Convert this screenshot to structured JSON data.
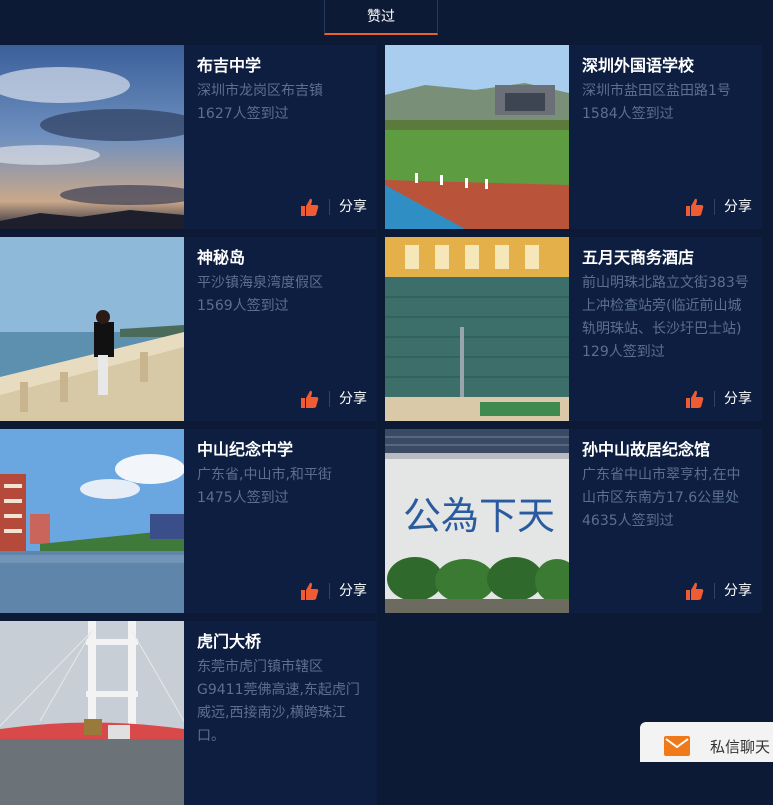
{
  "tabs": {
    "active_label": "赞过"
  },
  "cards": [
    {
      "title": "布吉中学",
      "address": "深圳市龙岗区布吉镇",
      "count": "1627人签到过",
      "share": "分享"
    },
    {
      "title": "深圳外国语学校",
      "address": "深圳市盐田区盐田路1号",
      "count": "1584人签到过",
      "share": "分享"
    },
    {
      "title": "神秘岛",
      "address": "平沙镇海泉湾度假区",
      "count": "1569人签到过",
      "share": "分享"
    },
    {
      "title": "五月天商务酒店",
      "address": "前山明珠北路立文街383号上冲检查站旁(临近前山城轨明珠站、长沙圩巴士站)",
      "count": "129人签到过",
      "share": "分享"
    },
    {
      "title": "中山纪念中学",
      "address": "广东省,中山市,和平街",
      "count": "1475人签到过",
      "share": "分享"
    },
    {
      "title": "孙中山故居纪念馆",
      "address": "广东省中山市翠亨村,在中山市区东南方17.6公里处",
      "count": "4635人签到过",
      "share": "分享"
    },
    {
      "title": "虎门大桥",
      "address": "东莞市虎门镇市辖区G9411莞佛高速,东起虎门威远,西接南沙,横跨珠江口。",
      "count": "",
      "share": ""
    }
  ],
  "photo_sign": "公為下天",
  "chat": {
    "label": "私信聊天"
  },
  "icons": {
    "like": "thumbs-up-icon",
    "chat": "envelope-icon"
  },
  "colors": {
    "background": "#0c1a36",
    "card": "#0d1e40",
    "accent": "#e8632a",
    "muted_text": "#5b6f93"
  }
}
